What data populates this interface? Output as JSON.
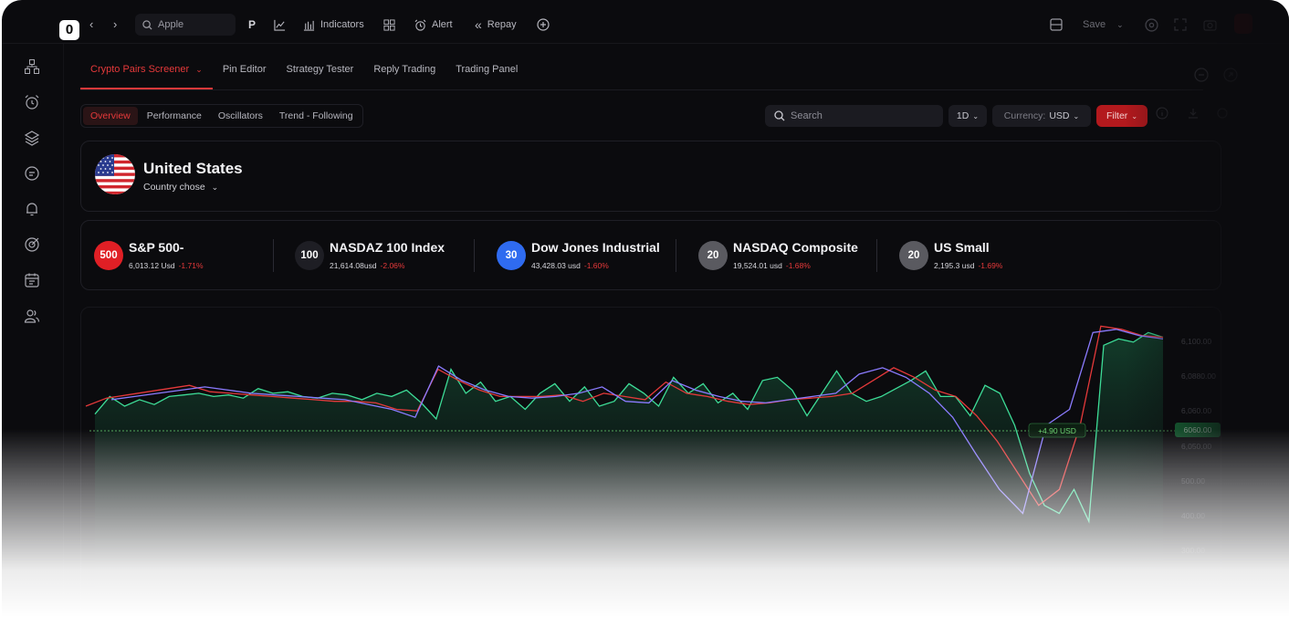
{
  "toolbar": {
    "logo": "0",
    "search_value": "Apple",
    "p_label": "P",
    "indicators_label": "Indicators",
    "alert_label": "Alert",
    "repay_label": "Repay",
    "save_label": "Save"
  },
  "tabs": [
    {
      "label": "Crypto Pairs Screener",
      "active": true
    },
    {
      "label": "Pin Editor"
    },
    {
      "label": "Strategy Tester"
    },
    {
      "label": "Reply Trading"
    },
    {
      "label": "Trading Panel"
    }
  ],
  "subtabs": [
    {
      "label": "Overview",
      "active": true
    },
    {
      "label": "Performance"
    },
    {
      "label": "Oscillators"
    },
    {
      "label": "Trend - Following"
    }
  ],
  "controls": {
    "search_placeholder": "Search",
    "interval": "1D",
    "currency_label": "Currency:",
    "currency_value": "USD",
    "filter_label": "Filter"
  },
  "country": {
    "name": "United States",
    "subtitle": "Country chose"
  },
  "indices": [
    {
      "badge": "500",
      "badge_color": "#e01f25",
      "name": "S&P 500-",
      "value": "6,013.12 Usd",
      "change": "-1.71%"
    },
    {
      "badge": "100",
      "badge_color": "#1e1e24",
      "name": "NASDAZ 100 Index",
      "value": "21,614.08usd",
      "change": "-2.06%"
    },
    {
      "badge": "30",
      "badge_color": "#2f6bf0",
      "name": "Dow Jones Industrial",
      "value": "43,428.03 usd",
      "change": "-1.60%"
    },
    {
      "badge": "20",
      "badge_color": "#5a5a60",
      "name": "NASDAQ Composite",
      "value": "19,524.01 usd",
      "change": "-1.68%"
    },
    {
      "badge": "20",
      "badge_color": "#5a5a60",
      "name": "US Small",
      "value": "2,195.3 usd",
      "change": "-1.69%"
    }
  ],
  "chart_data": {
    "type": "line",
    "price_label": "+4.90 USD",
    "current_tag": "6060.00",
    "y_ticks": [
      "6,100.00",
      "6,0880.00",
      "6,060.00",
      "6,050.00",
      "500.00",
      "400.00",
      "300.00"
    ],
    "series": [
      {
        "color": "#3ddc97",
        "values": [
          6047,
          6058,
          6052,
          6056,
          6053,
          6058,
          6059,
          6060,
          6058,
          6059,
          6057,
          6063,
          6060,
          6061,
          6058,
          6057,
          6060,
          6059,
          6056,
          6060,
          6058,
          6062,
          6054,
          6044,
          6075,
          6060,
          6067,
          6055,
          6058,
          6050,
          6060,
          6066,
          6055,
          6064,
          6052,
          6055,
          6066,
          6060,
          6052,
          6070,
          6060,
          6066,
          6054,
          6060,
          6050,
          6068,
          6070,
          6062,
          6046,
          6060,
          6074,
          6060,
          6055,
          6058,
          6063,
          6068,
          6074,
          6058,
          6058,
          6046,
          6065,
          6060,
          6040,
          6010,
          5990,
          5985,
          6000,
          5980,
          6090,
          6094,
          6092,
          6098,
          6095
        ]
      },
      {
        "color": "#e5393a",
        "values": [
          6052,
          6057,
          6059,
          6061,
          6063,
          6065,
          6061,
          6060,
          6059,
          6058,
          6057,
          6056,
          6055,
          6055,
          6054,
          6050,
          6049,
          6075,
          6068,
          6062,
          6058,
          6058,
          6058,
          6059,
          6055,
          6060,
          6058,
          6056,
          6067,
          6060,
          6058,
          6055,
          6053,
          6054,
          6056,
          6057,
          6058,
          6060,
          6068,
          6076,
          6070,
          6062,
          6058,
          6046,
          6030,
          6010,
          5990,
          6000,
          6040,
          6102,
          6100,
          6096,
          6095
        ]
      },
      {
        "color": "#8b7bff",
        "values": [
          6056,
          6058,
          6060,
          6062,
          6064,
          6062,
          6060,
          6059,
          6058,
          6057,
          6056,
          6053,
          6050,
          6045,
          6077,
          6068,
          6062,
          6058,
          6057,
          6058,
          6060,
          6064,
          6055,
          6054,
          6068,
          6062,
          6058,
          6055,
          6054,
          6056,
          6058,
          6060,
          6072,
          6076,
          6070,
          6060,
          6045,
          6022,
          6000,
          5985,
          6040,
          6050,
          6098,
          6100,
          6096,
          6094
        ]
      }
    ]
  }
}
